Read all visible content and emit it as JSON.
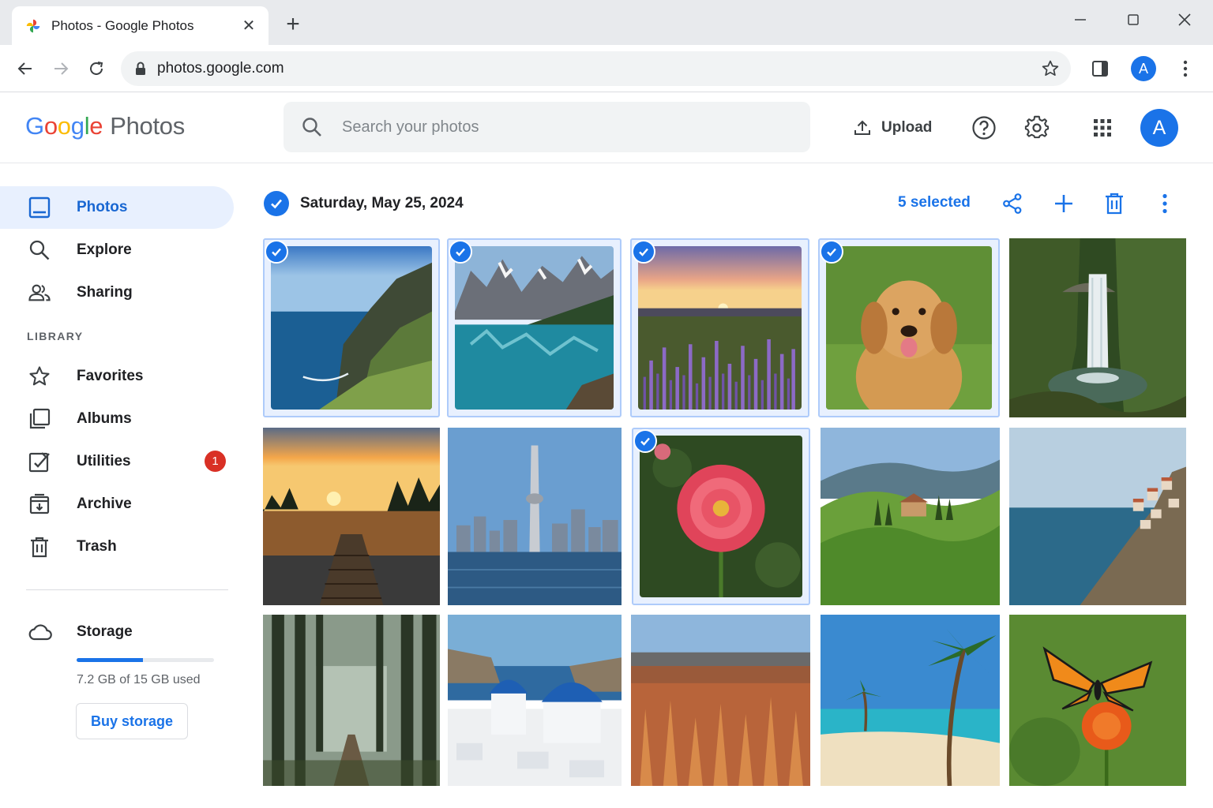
{
  "browser": {
    "tab_title": "Photos - Google Photos",
    "url": "photos.google.com",
    "profile_initial": "A"
  },
  "header": {
    "logo_letters": [
      "G",
      "o",
      "o",
      "g",
      "l",
      "e"
    ],
    "logo_product": "Photos",
    "search_placeholder": "Search your photos",
    "upload_label": "Upload",
    "avatar_initial": "A"
  },
  "sidebar": {
    "nav": [
      {
        "label": "Photos",
        "icon": "photo-icon",
        "active": true
      },
      {
        "label": "Explore",
        "icon": "search-icon"
      },
      {
        "label": "Sharing",
        "icon": "people-icon"
      }
    ],
    "library_heading": "LIBRARY",
    "library": [
      {
        "label": "Favorites",
        "icon": "star-icon"
      },
      {
        "label": "Albums",
        "icon": "albums-icon"
      },
      {
        "label": "Utilities",
        "icon": "utilities-icon",
        "badge": "1"
      },
      {
        "label": "Archive",
        "icon": "archive-icon"
      },
      {
        "label": "Trash",
        "icon": "trash-icon"
      }
    ],
    "storage": {
      "label": "Storage",
      "used_text": "7.2 GB of 15 GB used",
      "used_fraction": 0.48,
      "buy_label": "Buy storage"
    }
  },
  "main": {
    "date_label": "Saturday, May 25, 2024",
    "selected_count": "5 selected",
    "photos": [
      {
        "subject": "sea cliff coastline",
        "selected": true
      },
      {
        "subject": "mountain lake reflection",
        "selected": true
      },
      {
        "subject": "lupine field at sunset",
        "selected": true
      },
      {
        "subject": "golden retriever",
        "selected": true
      },
      {
        "subject": "forest waterfall",
        "selected": false
      },
      {
        "subject": "lake dock at sunset",
        "selected": false
      },
      {
        "subject": "city skyline with tower",
        "selected": false
      },
      {
        "subject": "pink dahlia flower",
        "selected": true
      },
      {
        "subject": "green rolling hills",
        "selected": false
      },
      {
        "subject": "coastal cliff village",
        "selected": false
      },
      {
        "subject": "misty forest path",
        "selected": false
      },
      {
        "subject": "blue dome churches",
        "selected": false
      },
      {
        "subject": "canyon hoodoos",
        "selected": false
      },
      {
        "subject": "tropical beach palms",
        "selected": false
      },
      {
        "subject": "monarch butterfly on flower",
        "selected": false
      }
    ]
  },
  "colors": {
    "accent": "#1a73e8",
    "active_nav_bg": "#e8f0fe",
    "badge": "#d93025"
  }
}
